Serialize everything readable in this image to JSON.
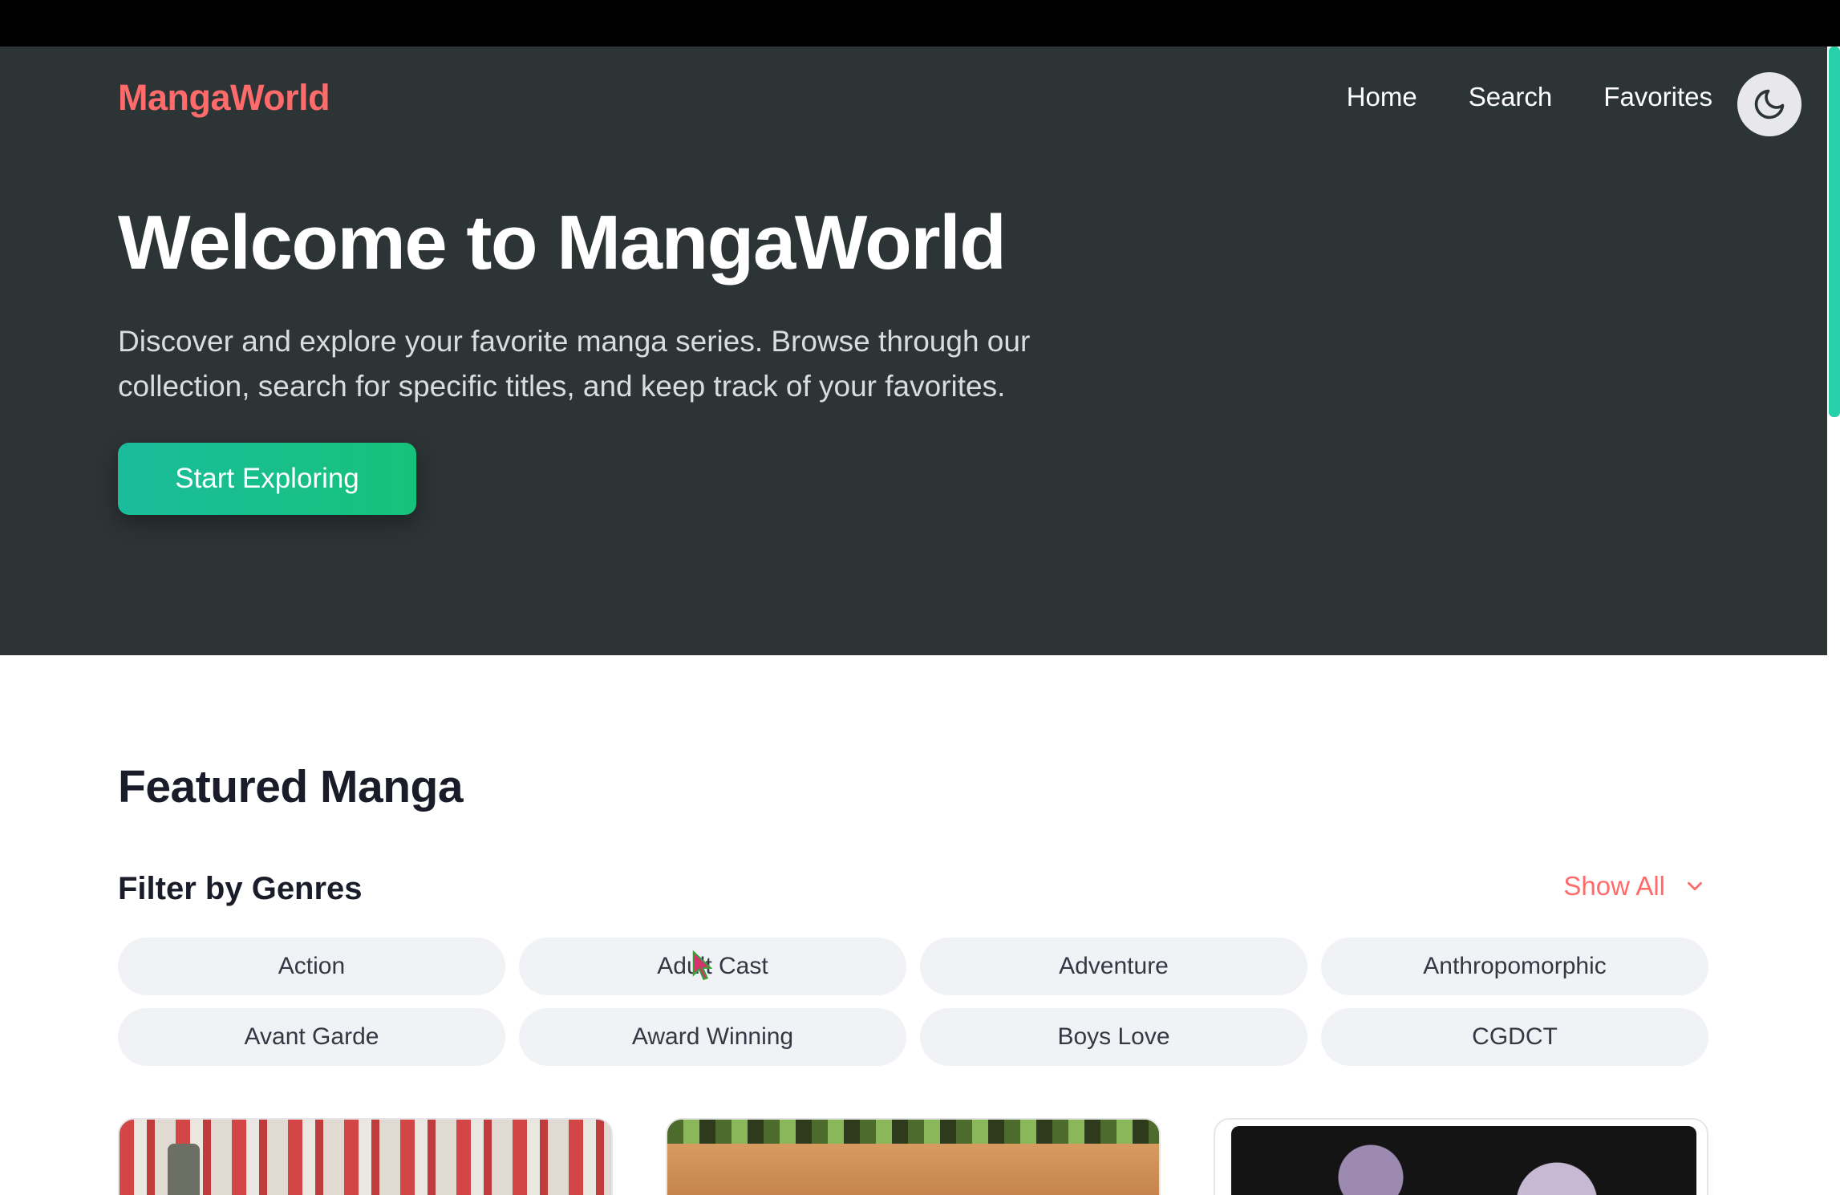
{
  "header": {
    "logo": "MangaWorld",
    "nav": [
      "Home",
      "Search",
      "Favorites"
    ],
    "theme_toggle_icon": "moon-icon"
  },
  "hero": {
    "title": "Welcome to MangaWorld",
    "description": "Discover and explore your favorite manga series. Browse through our collection, search for specific titles, and keep track of your favorites.",
    "cta_label": "Start Exploring"
  },
  "featured": {
    "title": "Featured Manga",
    "filter_title": "Filter by Genres",
    "show_all_label": "Show All",
    "show_all_icon": "chevron-down-icon",
    "genres": [
      "Action",
      "Adult Cast",
      "Adventure",
      "Anthropomorphic",
      "Avant Garde",
      "Award Winning",
      "Boys Love",
      "CGDCT"
    ]
  },
  "colors": {
    "brand": "#ff6b6b",
    "hero_bg": "#2d3436",
    "cta_start": "#1abc9c",
    "cta_end": "#16c27a",
    "chip_bg": "#f1f2f5"
  }
}
